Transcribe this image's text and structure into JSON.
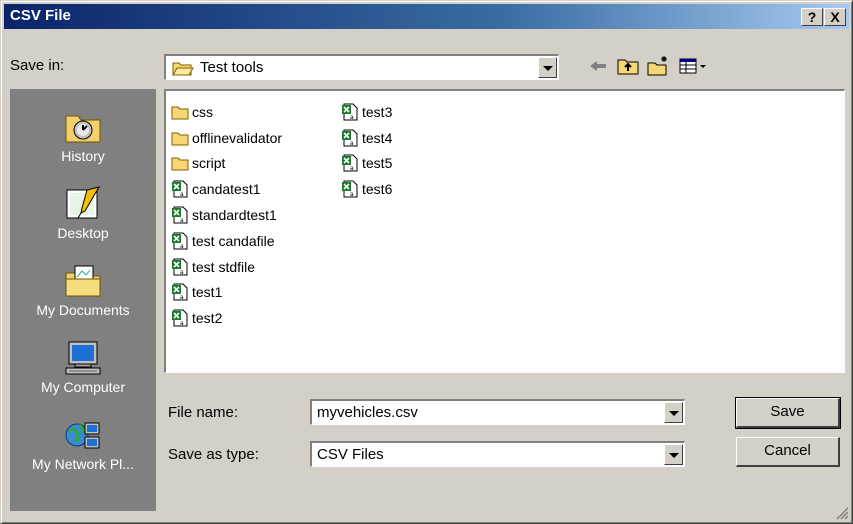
{
  "window": {
    "title": "CSV File",
    "help_label": "?",
    "close_label": "X"
  },
  "save_in": {
    "label": "Save in:",
    "folder": "Test tools"
  },
  "places": [
    {
      "label": "History",
      "icon": "history-icon"
    },
    {
      "label": "Desktop",
      "icon": "desktop-icon"
    },
    {
      "label": "My Documents",
      "icon": "my-documents-icon"
    },
    {
      "label": "My Computer",
      "icon": "my-computer-icon"
    },
    {
      "label": "My Network Pl...",
      "icon": "my-network-places-icon"
    }
  ],
  "files": {
    "col1": [
      {
        "name": "css",
        "type": "folder"
      },
      {
        "name": "offlinevalidator",
        "type": "folder"
      },
      {
        "name": "script",
        "type": "folder"
      },
      {
        "name": "candatest1",
        "type": "csv"
      },
      {
        "name": "standardtest1",
        "type": "csv"
      },
      {
        "name": "test candafile",
        "type": "csv"
      },
      {
        "name": "test stdfile",
        "type": "csv"
      },
      {
        "name": "test1",
        "type": "csv"
      },
      {
        "name": "test2",
        "type": "csv"
      }
    ],
    "col2": [
      {
        "name": "test3",
        "type": "csv"
      },
      {
        "name": "test4",
        "type": "csv"
      },
      {
        "name": "test5",
        "type": "csv"
      },
      {
        "name": "test6",
        "type": "csv"
      }
    ]
  },
  "file_name": {
    "label": "File name:",
    "value": "myvehicles.csv"
  },
  "save_type": {
    "label": "Save as type:",
    "value": "CSV Files"
  },
  "buttons": {
    "save": "Save",
    "cancel": "Cancel"
  },
  "colors": {
    "title_start": "#0a246a",
    "title_end": "#a6caf0",
    "face": "#d4d0c8",
    "places_bg": "#808080"
  }
}
